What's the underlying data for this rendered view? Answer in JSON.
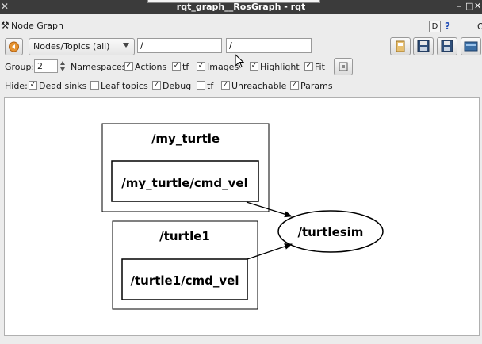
{
  "window": {
    "title": "rqt_graph__RosGraph - rqt"
  },
  "header": {
    "label": "Node Graph",
    "d_button": "D",
    "help_button": "?",
    "close_glyph": "O"
  },
  "toolbar": {
    "refresh_icon": "refresh-icon",
    "filter_mode": "Nodes/Topics (all)",
    "node_filter": "/",
    "topic_filter": "/",
    "right_icons": [
      "load-dot-icon",
      "save-dot-icon",
      "save-svg-icon",
      "screenshot-icon"
    ]
  },
  "group_row": {
    "group_label": "Group:",
    "group_value": "2",
    "namespaces": {
      "label": "Namespaces",
      "checked": true
    },
    "actions": {
      "label": "Actions",
      "checked": true
    },
    "tf": {
      "label": "tf",
      "checked": true
    },
    "images": {
      "label": "Images",
      "checked": true
    },
    "highlight": {
      "label": "Highlight",
      "checked": true
    },
    "fit": {
      "label": "Fit",
      "checked": true
    },
    "fit_button_icon": "fit-view-icon"
  },
  "hide_row": {
    "hide_label": "Hide:",
    "dead_sinks": {
      "label": "Dead sinks",
      "checked": true
    },
    "leaf_topics": {
      "label": "Leaf topics",
      "checked": false
    },
    "debug": {
      "label": "Debug",
      "checked": true
    },
    "tf": {
      "label": "tf",
      "checked": false
    },
    "unreachable": {
      "label": "Unreachable",
      "checked": true
    },
    "params": {
      "label": "Params",
      "checked": true
    }
  },
  "graph": {
    "namespaces": [
      {
        "name": "/my_turtle",
        "topic": "/my_turtle/cmd_vel"
      },
      {
        "name": "/turtle1",
        "topic": "/turtle1/cmd_vel"
      }
    ],
    "node": "/turtlesim"
  },
  "colors": {
    "titlebar": "#3b3b3b",
    "help_accent": "#2752b8",
    "canvas": "#ffffff"
  }
}
